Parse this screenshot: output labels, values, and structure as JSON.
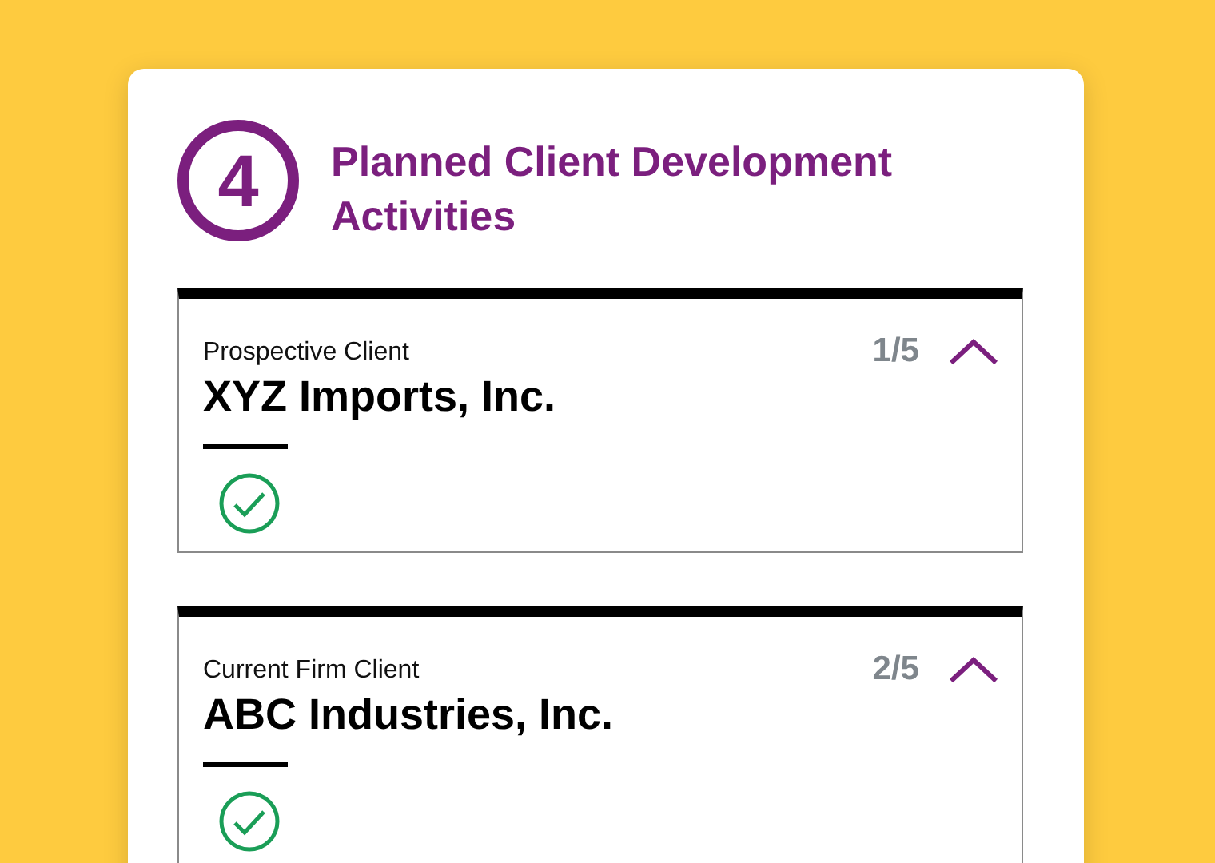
{
  "step": {
    "number": "4",
    "title": "Planned Client Development Activities"
  },
  "clients": [
    {
      "category": "Prospective Client",
      "name": "XYZ Imports, Inc.",
      "counter": "1/5",
      "expanded": true,
      "completed": true
    },
    {
      "category": "Current Firm Client",
      "name": "ABC Industries, Inc.",
      "counter": "2/5",
      "expanded": true,
      "completed": true
    }
  ]
}
